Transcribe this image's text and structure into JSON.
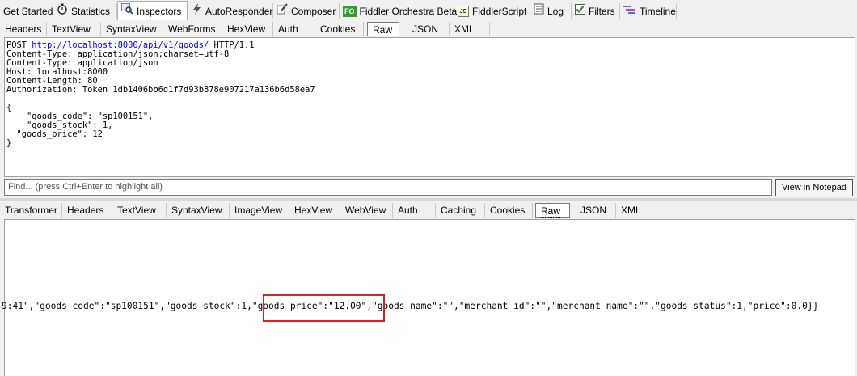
{
  "top_tabs": [
    {
      "label": "Get Started",
      "icon": "none"
    },
    {
      "label": "Statistics",
      "icon": "stopwatch-icon"
    },
    {
      "label": "Inspectors",
      "icon": "magnifier-icon"
    },
    {
      "label": "AutoResponder",
      "icon": "lightning-icon"
    },
    {
      "label": "Composer",
      "icon": "pencil-icon"
    },
    {
      "label": "Fiddler Orchestra Beta",
      "icon": "fo-icon",
      "icon_text": "FO"
    },
    {
      "label": "FiddlerScript",
      "icon": "script-icon",
      "icon_text": "JS"
    },
    {
      "label": "Log",
      "icon": "log-icon"
    },
    {
      "label": "Filters",
      "icon": "checkbox-icon"
    },
    {
      "label": "Timeline",
      "icon": "timeline-icon"
    }
  ],
  "active_top_tab": "Inspectors",
  "request_tabs": [
    "Headers",
    "TextView",
    "SyntaxView",
    "WebForms",
    "HexView",
    "Auth",
    "Cookies",
    "Raw",
    "JSON",
    "XML"
  ],
  "request_selected": "Raw",
  "request_raw": {
    "method": "POST ",
    "url": "http://localhost:8000/api/v1/goods/",
    "protocol": " HTTP/1.1",
    "body": "Content-Type: application/json;charset=utf-8\nContent-Type: application/json\nHost: localhost:8000\nContent-Length: 80\nAuthorization: Token 1db1406bb6d1f7d93b878e907217a136b6d58ea7\n\n{\n    \"goods_code\": \"sp100151\",\n    \"goods_stock\": 1,\n  \"goods_price\": 12\n}"
  },
  "find": {
    "placeholder": "Find... (press Ctrl+Enter to highlight all)",
    "button": "View in Notepad"
  },
  "response_tabs": [
    "Transformer",
    "Headers",
    "TextView",
    "SyntaxView",
    "ImageView",
    "HexView",
    "WebView",
    "Auth",
    "Caching",
    "Cookies",
    "Raw",
    "JSON",
    "XML"
  ],
  "response_selected": "Raw",
  "response_raw": "9:41\",\"goods_code\":\"sp100151\",\"goods_stock\":1,\"goods_price\":\"12.00\",\"goods_name\":\"\",\"merchant_id\":\"\",\"merchant_name\":\"\",\"goods_status\":1,\"price\":0.0}}",
  "colors": {
    "highlight": "#e02020",
    "link": "#0000ee",
    "fo_green": "#2e9e2e"
  }
}
